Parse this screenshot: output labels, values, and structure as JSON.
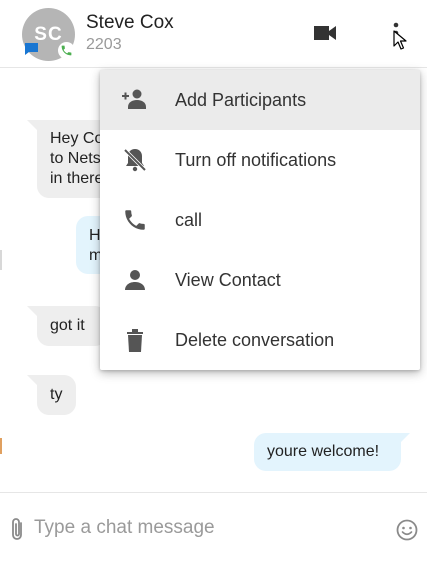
{
  "header": {
    "avatar_initials": "SC",
    "contact_name": "Steve Cox",
    "contact_ext": "2203"
  },
  "messages": [
    {
      "direction": "in",
      "text_lines": [
        "Hey Co",
        "to Nets",
        "in there"
      ]
    },
    {
      "direction": "out",
      "text_lines": [
        "H",
        "m"
      ]
    },
    {
      "direction": "in",
      "text": "got it"
    },
    {
      "direction": "in",
      "text": "ty"
    },
    {
      "direction": "out",
      "text": "youre welcome!"
    }
  ],
  "menu": {
    "items": [
      {
        "label": "Add Participants",
        "icon": "person-add-icon",
        "active": true
      },
      {
        "label": "Turn off notifications",
        "icon": "notifications-off-icon",
        "active": false
      },
      {
        "label": "call",
        "icon": "phone-icon",
        "active": false
      },
      {
        "label": "View Contact",
        "icon": "person-icon",
        "active": false
      },
      {
        "label": "Delete conversation",
        "icon": "trash-icon",
        "active": false
      }
    ]
  },
  "composer": {
    "placeholder": "Type a chat message"
  },
  "colors": {
    "avatar_bg": "#b5b5b5",
    "chat_badge": "#1976d2",
    "phone_badge": "#4caf50",
    "incoming_bubble": "#eeeeee",
    "outgoing_bubble": "#e3f4fd",
    "menu_active": "#ebebeb"
  }
}
